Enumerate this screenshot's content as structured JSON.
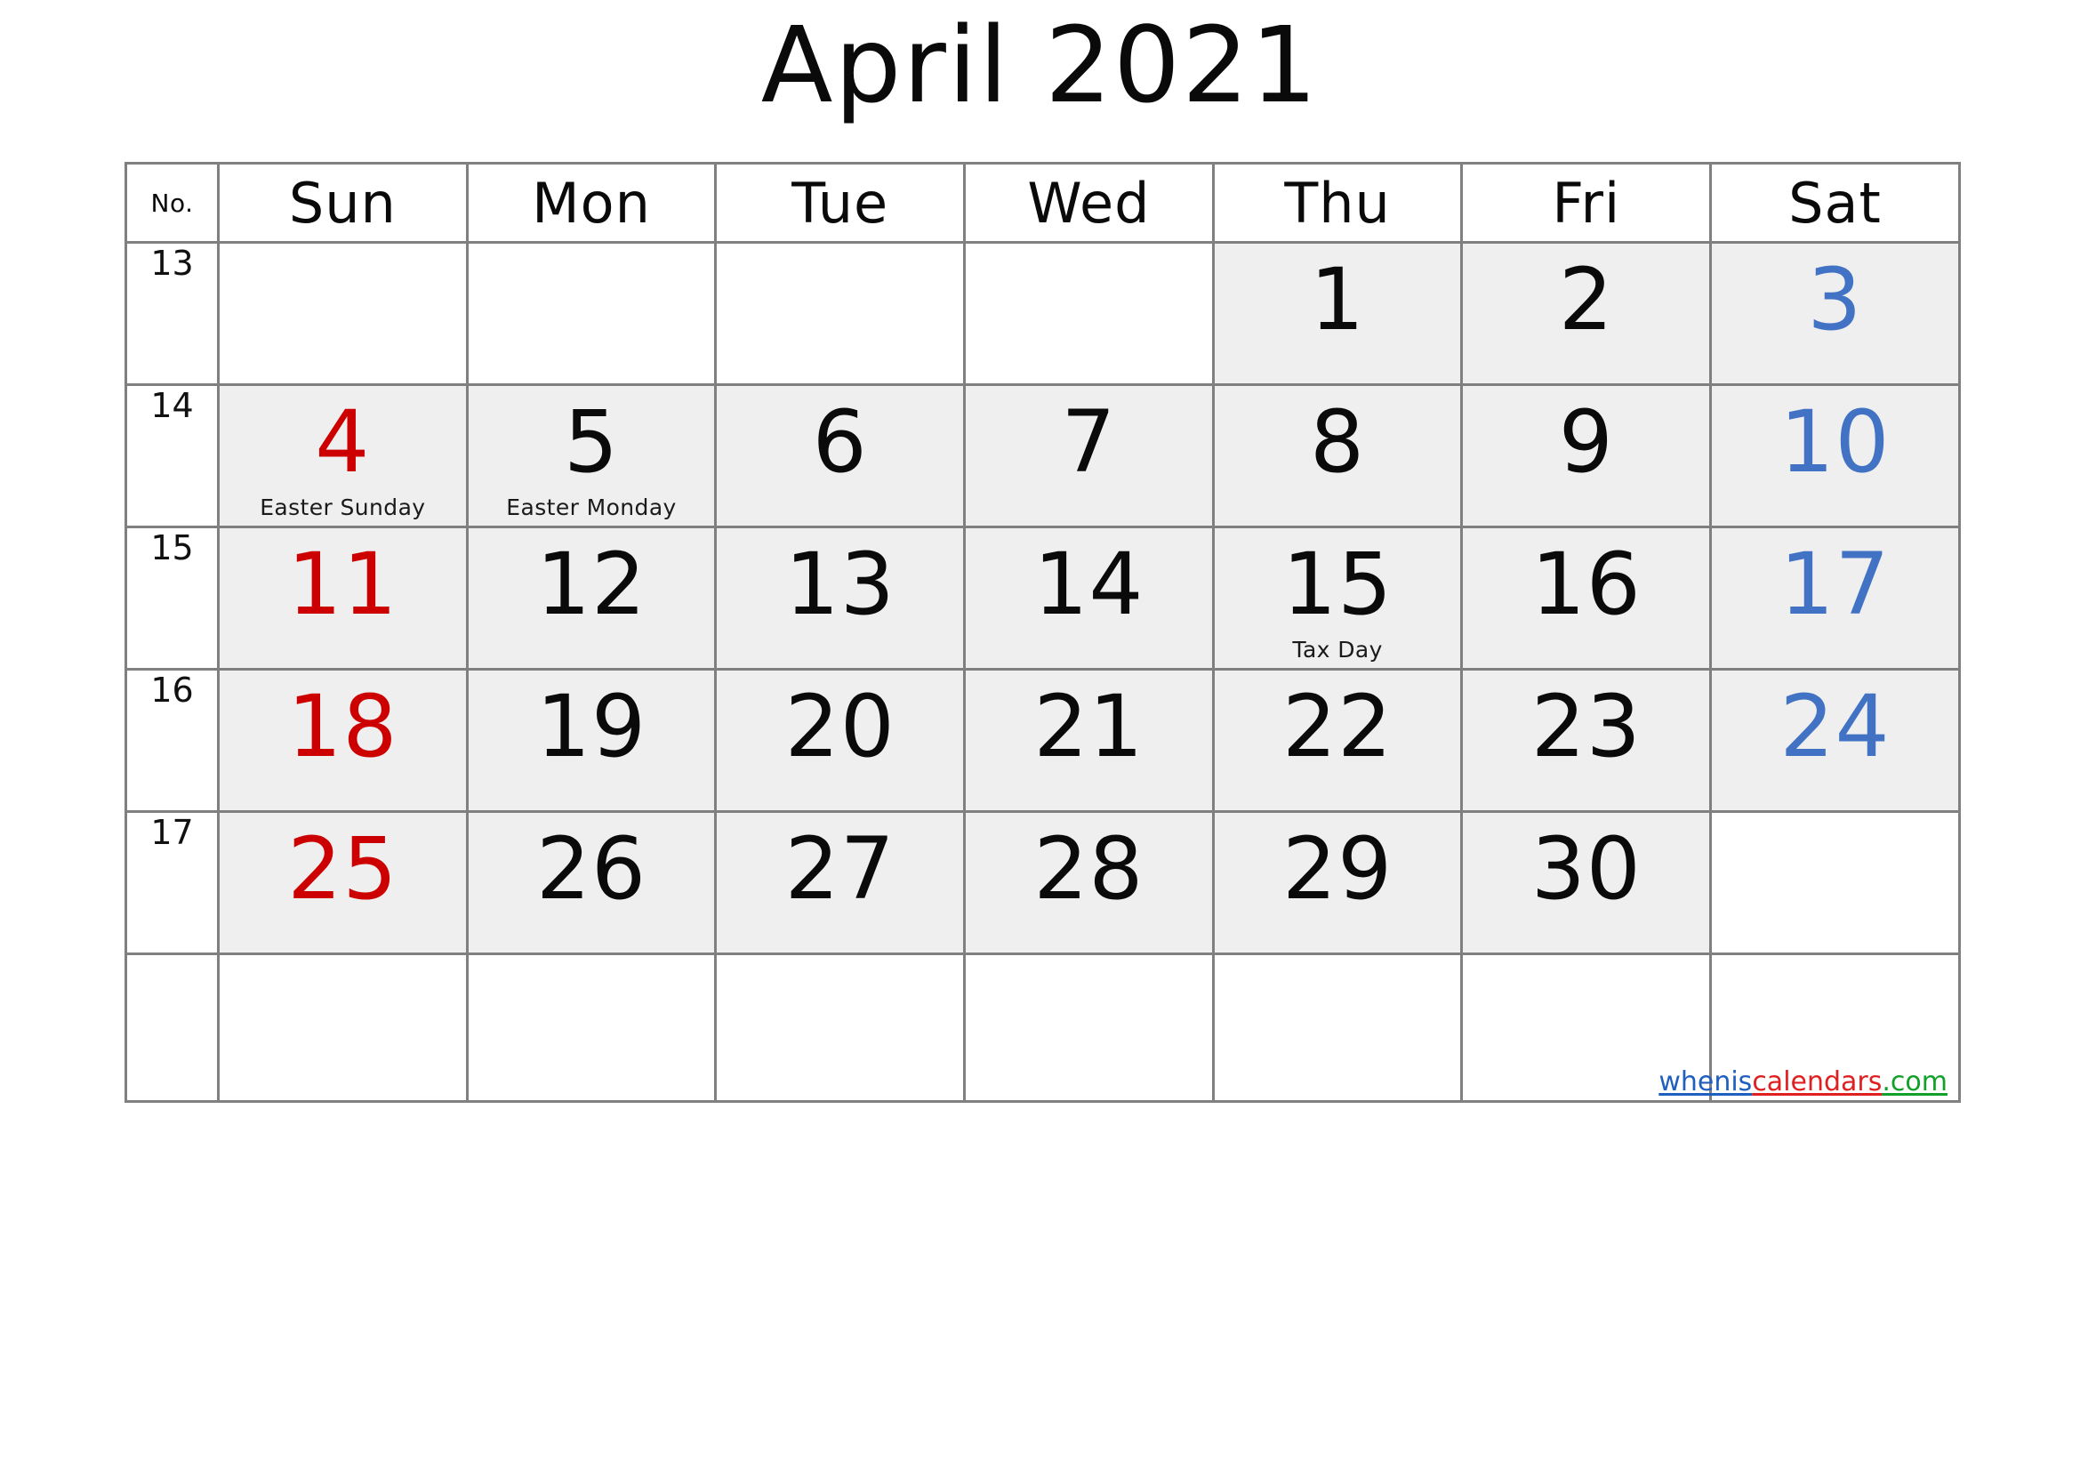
{
  "title": "April 2021",
  "header": {
    "week_no_label": "No.",
    "days": [
      "Sun",
      "Mon",
      "Tue",
      "Wed",
      "Thu",
      "Fri",
      "Sat"
    ]
  },
  "colors": {
    "sunday": "#cc0000",
    "saturday": "#4272c4",
    "weekday": "#0a0a0a",
    "shaded_cell": "#efefef",
    "grid_line": "#808080",
    "watermark_blue": "#1f5fbf",
    "watermark_red": "#e02020",
    "watermark_green": "#11a02a"
  },
  "watermark": {
    "part1": "whenis",
    "part2": "calendars",
    "part3": ".com"
  },
  "weeks": [
    {
      "no": "13",
      "days": [
        {
          "num": "",
          "event": "",
          "shaded": false,
          "kind": "sun"
        },
        {
          "num": "",
          "event": "",
          "shaded": false,
          "kind": "wd"
        },
        {
          "num": "",
          "event": "",
          "shaded": false,
          "kind": "wd"
        },
        {
          "num": "",
          "event": "",
          "shaded": false,
          "kind": "wd"
        },
        {
          "num": "1",
          "event": "",
          "shaded": true,
          "kind": "wd"
        },
        {
          "num": "2",
          "event": "",
          "shaded": true,
          "kind": "wd"
        },
        {
          "num": "3",
          "event": "",
          "shaded": true,
          "kind": "sat"
        }
      ]
    },
    {
      "no": "14",
      "days": [
        {
          "num": "4",
          "event": "Easter Sunday",
          "shaded": true,
          "kind": "sun"
        },
        {
          "num": "5",
          "event": "Easter Monday",
          "shaded": true,
          "kind": "wd"
        },
        {
          "num": "6",
          "event": "",
          "shaded": true,
          "kind": "wd"
        },
        {
          "num": "7",
          "event": "",
          "shaded": true,
          "kind": "wd"
        },
        {
          "num": "8",
          "event": "",
          "shaded": true,
          "kind": "wd"
        },
        {
          "num": "9",
          "event": "",
          "shaded": true,
          "kind": "wd"
        },
        {
          "num": "10",
          "event": "",
          "shaded": true,
          "kind": "sat"
        }
      ]
    },
    {
      "no": "15",
      "days": [
        {
          "num": "11",
          "event": "",
          "shaded": true,
          "kind": "sun"
        },
        {
          "num": "12",
          "event": "",
          "shaded": true,
          "kind": "wd"
        },
        {
          "num": "13",
          "event": "",
          "shaded": true,
          "kind": "wd"
        },
        {
          "num": "14",
          "event": "",
          "shaded": true,
          "kind": "wd"
        },
        {
          "num": "15",
          "event": "Tax Day",
          "shaded": true,
          "kind": "wd"
        },
        {
          "num": "16",
          "event": "",
          "shaded": true,
          "kind": "wd"
        },
        {
          "num": "17",
          "event": "",
          "shaded": true,
          "kind": "sat"
        }
      ]
    },
    {
      "no": "16",
      "days": [
        {
          "num": "18",
          "event": "",
          "shaded": true,
          "kind": "sun"
        },
        {
          "num": "19",
          "event": "",
          "shaded": true,
          "kind": "wd"
        },
        {
          "num": "20",
          "event": "",
          "shaded": true,
          "kind": "wd"
        },
        {
          "num": "21",
          "event": "",
          "shaded": true,
          "kind": "wd"
        },
        {
          "num": "22",
          "event": "",
          "shaded": true,
          "kind": "wd"
        },
        {
          "num": "23",
          "event": "",
          "shaded": true,
          "kind": "wd"
        },
        {
          "num": "24",
          "event": "",
          "shaded": true,
          "kind": "sat"
        }
      ]
    },
    {
      "no": "17",
      "days": [
        {
          "num": "25",
          "event": "",
          "shaded": true,
          "kind": "sun"
        },
        {
          "num": "26",
          "event": "",
          "shaded": true,
          "kind": "wd"
        },
        {
          "num": "27",
          "event": "",
          "shaded": true,
          "kind": "wd"
        },
        {
          "num": "28",
          "event": "",
          "shaded": true,
          "kind": "wd"
        },
        {
          "num": "29",
          "event": "",
          "shaded": true,
          "kind": "wd"
        },
        {
          "num": "30",
          "event": "",
          "shaded": true,
          "kind": "wd"
        },
        {
          "num": "",
          "event": "",
          "shaded": false,
          "kind": "sat"
        }
      ]
    },
    {
      "no": "",
      "days": [
        {
          "num": "",
          "event": "",
          "shaded": false,
          "kind": "sun"
        },
        {
          "num": "",
          "event": "",
          "shaded": false,
          "kind": "wd"
        },
        {
          "num": "",
          "event": "",
          "shaded": false,
          "kind": "wd"
        },
        {
          "num": "",
          "event": "",
          "shaded": false,
          "kind": "wd"
        },
        {
          "num": "",
          "event": "",
          "shaded": false,
          "kind": "wd"
        },
        {
          "num": "",
          "event": "",
          "shaded": false,
          "kind": "wd"
        },
        {
          "num": "",
          "event": "",
          "shaded": false,
          "kind": "sat"
        }
      ]
    }
  ]
}
